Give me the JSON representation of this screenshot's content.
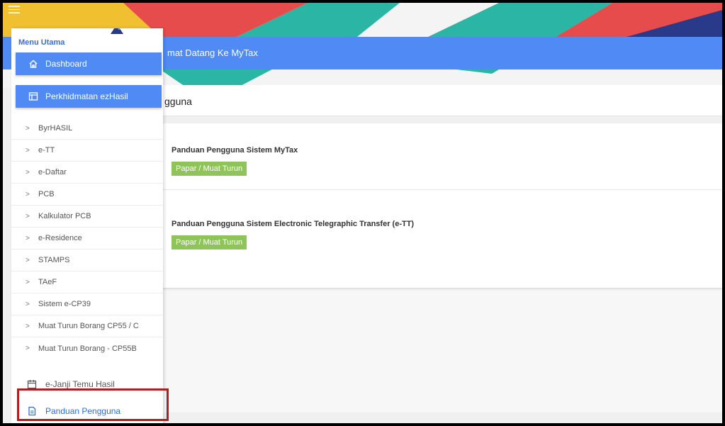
{
  "header": {
    "welcome": "mat Datang Ke MyTax",
    "page_title": "gguna"
  },
  "sidebar": {
    "heading": "Menu Utama",
    "dashboard_label": "Dashboard",
    "ezhasil_label": "Perkhidmatan ezHasil",
    "items": [
      {
        "label": "ByrHASIL"
      },
      {
        "label": "e-TT"
      },
      {
        "label": "e-Daftar"
      },
      {
        "label": "PCB"
      },
      {
        "label": "Kalkulator PCB"
      },
      {
        "label": "e-Residence"
      },
      {
        "label": "STAMPS"
      },
      {
        "label": "TAeF"
      },
      {
        "label": "Sistem e-CP39"
      },
      {
        "label": "Muat Turun Borang CP55 / C"
      },
      {
        "label": "Muat Turun Borang - CP55B"
      }
    ],
    "janji_label": "e-Janji Temu Hasil",
    "panduan_label": "Panduan Pengguna"
  },
  "documents": [
    {
      "title": "Panduan Pengguna Sistem MyTax",
      "button": "Papar / Muat Turun"
    },
    {
      "title": "Panduan Pengguna Sistem Electronic Telegraphic Transfer (e-TT)",
      "button": "Papar / Muat Turun"
    }
  ],
  "colors": {
    "accent": "#4f8af5",
    "button_green": "#8fc45a",
    "highlight": "#b01e1e"
  },
  "icons": {
    "dashboard": "home-icon",
    "ezhasil": "window-icon",
    "janji": "calendar-icon",
    "panduan": "document-icon"
  }
}
